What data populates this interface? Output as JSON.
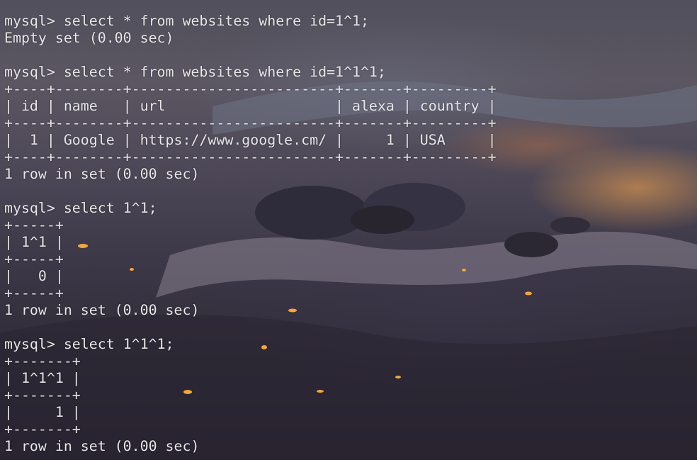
{
  "terminal": {
    "lines": [
      "mysql> select * from websites where id=1^1;",
      "Empty set (0.00 sec)",
      "",
      "mysql> select * from websites where id=1^1^1;",
      "+----+--------+------------------------+-------+---------+",
      "| id | name   | url                    | alexa | country |",
      "+----+--------+------------------------+-------+---------+",
      "|  1 | Google | https://www.google.cm/ |     1 | USA     |",
      "+----+--------+------------------------+-------+---------+",
      "1 row in set (0.00 sec)",
      "",
      "mysql> select 1^1;",
      "+-----+",
      "| 1^1 |",
      "+-----+",
      "|   0 |",
      "+-----+",
      "1 row in set (0.00 sec)",
      "",
      "mysql> select 1^1^1;",
      "+-------+",
      "| 1^1^1 |",
      "+-------+",
      "|     1 |",
      "+-------+",
      "1 row in set (0.00 sec)"
    ]
  },
  "colors": {
    "text": "#e6e6e6",
    "background_top": "#51505c",
    "background_bottom": "#27232f",
    "sunset_glow": "#ffaa50"
  }
}
